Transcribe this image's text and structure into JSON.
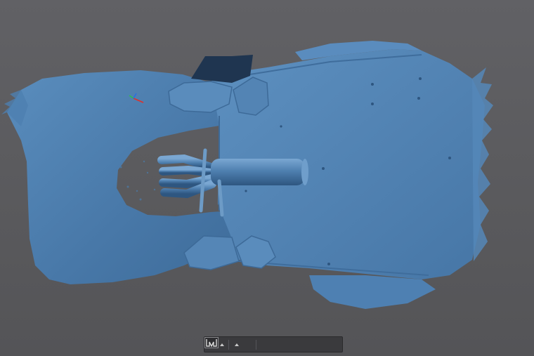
{
  "viewport": {
    "model": "scanned-car-body-underside",
    "mesh_color": "#4a7fb0",
    "mesh_shadow": "#355f8a",
    "mesh_highlight": "#6c9ccb",
    "background": "#5b5b5e",
    "triad_colors": {
      "x": "#e0302a",
      "y": "#2ec04a",
      "z": "#2a70e0"
    }
  },
  "toolbar": {
    "buttons": [
      {
        "icon": "view-cube-icon",
        "has_menu": true
      },
      {
        "icon": "surface-shading-icon",
        "has_menu": true
      },
      {
        "icon": "color-map-icon",
        "has_menu": true
      },
      {
        "icon": "wireframe-box-icon",
        "has_menu": false
      },
      {
        "icon": "section-plane-icon",
        "has_menu": false
      },
      {
        "icon": "clipping-icon",
        "has_menu": false
      },
      {
        "icon": "w-logo-icon",
        "has_menu": false
      }
    ]
  }
}
